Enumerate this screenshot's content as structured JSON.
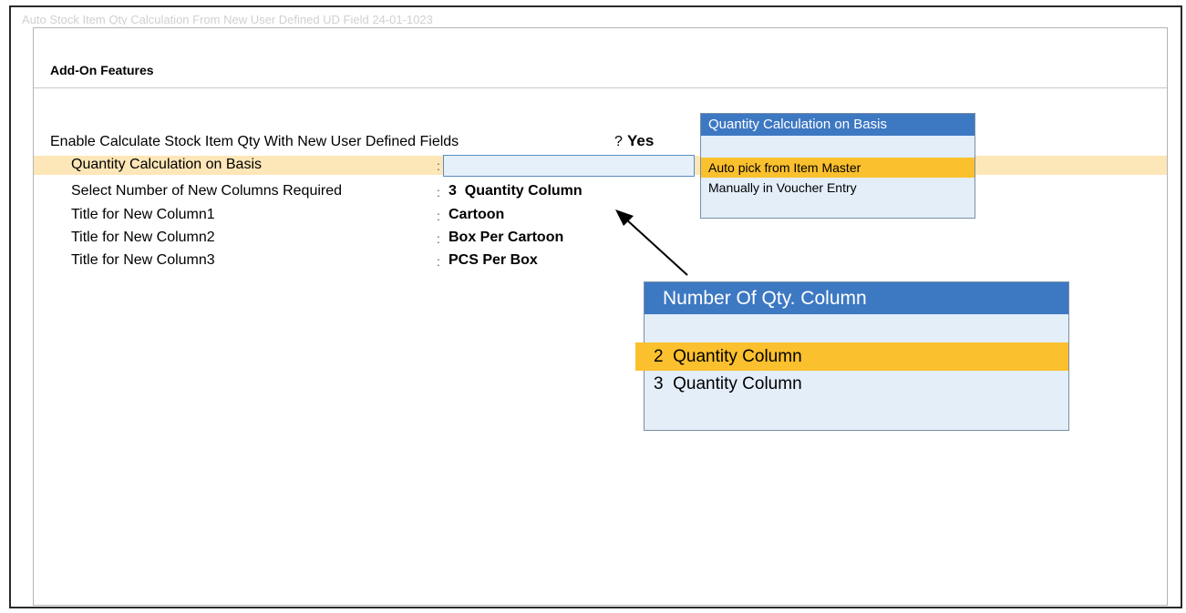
{
  "window": {
    "background_title": "Auto Stock Item Qty Calculation From New User Defined UD Field 24-01-1023"
  },
  "panel": {
    "title": "Add-On Features"
  },
  "fields": {
    "enable": {
      "label": "Enable Calculate Stock Item Qty With New User Defined Fields",
      "sep": "?",
      "value": "Yes"
    },
    "basis": {
      "label": "Quantity Calculation on Basis",
      "sep": ":",
      "value": ""
    },
    "columns": {
      "label": "Select Number of New Columns Required",
      "sep": ":",
      "value": "3  Quantity Column"
    },
    "col1": {
      "label": "Title for New Column1",
      "sep": ":",
      "value": "Cartoon"
    },
    "col2": {
      "label": "Title for New Column2",
      "sep": ":",
      "value": "Box Per Cartoon"
    },
    "col3": {
      "label": "Title for New Column3",
      "sep": ":",
      "value": "PCS Per Box"
    }
  },
  "basis_popup": {
    "title": "Quantity Calculation on Basis",
    "items": [
      "Auto pick from Item Master",
      "Manually in Voucher Entry"
    ],
    "selected_index": 0
  },
  "qty_popup": {
    "title": "Number Of Qty. Column",
    "items": [
      "2  Quantity Column",
      "3  Quantity Column"
    ],
    "selected_index": 0
  },
  "colors": {
    "popup_header": "#3d78c2",
    "popup_bg": "#e3eef9",
    "selection": "#fbc02d",
    "row_highlight": "#fde7b8"
  }
}
